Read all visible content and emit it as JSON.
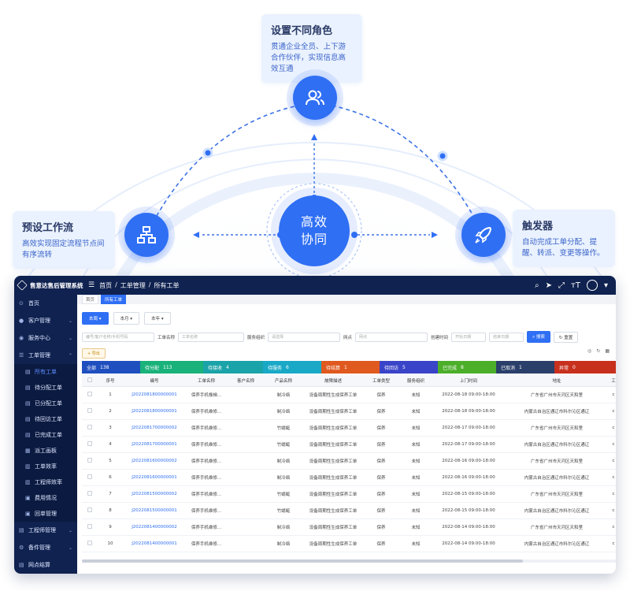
{
  "diagram": {
    "top": {
      "title": "设置不同角色",
      "desc": "贯通企业全员、上下游合作伙伴，实现信息高效互通"
    },
    "left": {
      "title": "预设工作流",
      "desc": "高效实现固定流程节点间有序流转"
    },
    "right": {
      "title": "触发器",
      "desc": "自动完成工单分配、提醒、转派、变更等操作。"
    },
    "center_line1": "高效",
    "center_line2": "协同",
    "accent": "#2f6ff4"
  },
  "app": {
    "brand": "售意达售后管理系统",
    "breadcrumb": [
      "首页",
      "/",
      "工单管理",
      "/",
      "所有工单"
    ],
    "tabs": [
      "首页",
      "所有工单"
    ],
    "sidebar": {
      "home": "首页",
      "customer": "客户管理",
      "service_center": "服务中心",
      "ticket": "工单管理",
      "sub": [
        "所有工单",
        "待分配工单",
        "已分配工单",
        "待回访工单",
        "已完成工单",
        "派工画板",
        "工单效率",
        "工程师效率",
        "费用情况",
        "回单管理"
      ],
      "engineer": "工程师管理",
      "parts": "备件管理",
      "settle": "网点结算"
    },
    "filters": {
      "today": "本周",
      "month": "本月",
      "year": "本年",
      "search_ph": "编号/客户名称/手机号码",
      "name_label": "工单名称",
      "name_ph": "工单名称",
      "org_label": "服务组织",
      "org_ph": "请选择",
      "site_label": "网点",
      "site_ph": "网点",
      "time_label": "创建时间",
      "start_ph": "开始日期",
      "end_ph": "结束日期",
      "search_btn": "搜索",
      "reset_btn": "重置",
      "export": "导出"
    },
    "status": [
      {
        "label": "全部",
        "count": "138",
        "color": "#1f4fbf"
      },
      {
        "label": "待分配",
        "count": "113",
        "color": "#19b27a"
      },
      {
        "label": "待接收",
        "count": "4",
        "color": "#1aa3a8"
      },
      {
        "label": "待服务",
        "count": "6",
        "color": "#19a9c7"
      },
      {
        "label": "待结算",
        "count": "1",
        "color": "#e0591f"
      },
      {
        "label": "待回访",
        "count": "5",
        "color": "#3a44c9"
      },
      {
        "label": "已完成",
        "count": "8",
        "color": "#4caf2a"
      },
      {
        "label": "已取消",
        "count": "1",
        "color": "#2a3f6a"
      },
      {
        "label": "异常",
        "count": "0",
        "color": "#c8301e"
      }
    ],
    "columns": [
      "",
      "序号",
      "编号",
      "工单名称",
      "客户名称",
      "产品名称",
      "故障描述",
      "工单类型",
      "服务组织",
      "上门时间",
      "地址",
      "工"
    ],
    "rows": [
      [
        "1",
        "J2022081800000001",
        "保养手机橡梯...",
        "",
        "制冷络",
        "设备周期性生成保养工单",
        "保养",
        "未知",
        "2022-08-18 09:00-18:00",
        "广东省广州市天河区天和里",
        "c"
      ],
      [
        "2",
        "J2022081800000001",
        "保养手机维修...",
        "",
        "制冷络",
        "设备周期性生成保养工单",
        "保养",
        "未知",
        "2022-08-18 09:00-18:00",
        "内蒙古自治区通辽市科尔沁区通辽",
        "c"
      ],
      [
        "3",
        "J2022081700000002",
        "保养手机维修...",
        "",
        "竹蜻蜓",
        "设备周期性生成保养工单",
        "保养",
        "未知",
        "2022-08-17 09:00-18:00",
        "广东省广州市天河区天和里",
        "c"
      ],
      [
        "4",
        "J2022081700000001",
        "保养手机维修...",
        "",
        "竹蜻蜓",
        "设备周期性生成保养工单",
        "保养",
        "未知",
        "2022-08-17 09:00-18:00",
        "内蒙古自治区通辽市科尔沁区通辽",
        "c"
      ],
      [
        "5",
        "J2022081600000002",
        "保养手机维修...",
        "",
        "制冷络",
        "设备周期性生成保养工单",
        "保养",
        "未知",
        "2022-08-16 09:00-18:00",
        "广东省广州市天河区天和里",
        "c"
      ],
      [
        "6",
        "J2022081600000001",
        "保养手机维修...",
        "",
        "制冷络",
        "设备周期性生成保养工单",
        "保养",
        "未知",
        "2022-08-16 09:00-18:00",
        "内蒙古自治区通辽市科尔沁区通辽",
        "c"
      ],
      [
        "7",
        "J2022081500000002",
        "保养手机维修...",
        "",
        "竹蜻蜓",
        "设备周期性生成保养工单",
        "保养",
        "未知",
        "2022-08-15 09:00-18:00",
        "广东省广州市天河区天和里",
        "c"
      ],
      [
        "8",
        "J2022081500000001",
        "保养手机维修...",
        "",
        "竹蜻蜓",
        "设备周期性生成保养工单",
        "保养",
        "未知",
        "2022-08-15 09:00-18:00",
        "内蒙古自治区通辽市科尔沁区通辽",
        "c"
      ],
      [
        "9",
        "J2022081400000002",
        "保养手机维修...",
        "",
        "制冷络",
        "设备周期性生成保养工单",
        "保养",
        "未知",
        "2022-08-14 09:00-18:00",
        "广东省广州市天河区天和里",
        "c"
      ],
      [
        "10",
        "J2022081400000001",
        "保养手机维修...",
        "",
        "制冷络",
        "设备周期性生成保养工单",
        "保养",
        "未知",
        "2022-08-14 09:00-18:00",
        "内蒙古自治区通辽市科尔沁区通辽",
        "c"
      ]
    ]
  }
}
